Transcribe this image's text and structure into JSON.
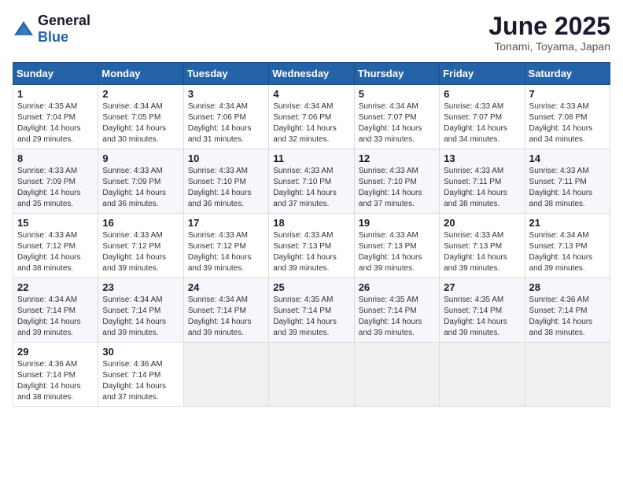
{
  "header": {
    "logo_general": "General",
    "logo_blue": "Blue",
    "month_title": "June 2025",
    "location": "Tonami, Toyama, Japan"
  },
  "calendar": {
    "days_of_week": [
      "Sunday",
      "Monday",
      "Tuesday",
      "Wednesday",
      "Thursday",
      "Friday",
      "Saturday"
    ],
    "weeks": [
      [
        {
          "day": "1",
          "sunrise": "4:35 AM",
          "sunset": "7:04 PM",
          "daylight": "14 hours and 29 minutes."
        },
        {
          "day": "2",
          "sunrise": "4:34 AM",
          "sunset": "7:05 PM",
          "daylight": "14 hours and 30 minutes."
        },
        {
          "day": "3",
          "sunrise": "4:34 AM",
          "sunset": "7:06 PM",
          "daylight": "14 hours and 31 minutes."
        },
        {
          "day": "4",
          "sunrise": "4:34 AM",
          "sunset": "7:06 PM",
          "daylight": "14 hours and 32 minutes."
        },
        {
          "day": "5",
          "sunrise": "4:34 AM",
          "sunset": "7:07 PM",
          "daylight": "14 hours and 33 minutes."
        },
        {
          "day": "6",
          "sunrise": "4:33 AM",
          "sunset": "7:07 PM",
          "daylight": "14 hours and 34 minutes."
        },
        {
          "day": "7",
          "sunrise": "4:33 AM",
          "sunset": "7:08 PM",
          "daylight": "14 hours and 34 minutes."
        }
      ],
      [
        {
          "day": "8",
          "sunrise": "4:33 AM",
          "sunset": "7:09 PM",
          "daylight": "14 hours and 35 minutes."
        },
        {
          "day": "9",
          "sunrise": "4:33 AM",
          "sunset": "7:09 PM",
          "daylight": "14 hours and 36 minutes."
        },
        {
          "day": "10",
          "sunrise": "4:33 AM",
          "sunset": "7:10 PM",
          "daylight": "14 hours and 36 minutes."
        },
        {
          "day": "11",
          "sunrise": "4:33 AM",
          "sunset": "7:10 PM",
          "daylight": "14 hours and 37 minutes."
        },
        {
          "day": "12",
          "sunrise": "4:33 AM",
          "sunset": "7:10 PM",
          "daylight": "14 hours and 37 minutes."
        },
        {
          "day": "13",
          "sunrise": "4:33 AM",
          "sunset": "7:11 PM",
          "daylight": "14 hours and 38 minutes."
        },
        {
          "day": "14",
          "sunrise": "4:33 AM",
          "sunset": "7:11 PM",
          "daylight": "14 hours and 38 minutes."
        }
      ],
      [
        {
          "day": "15",
          "sunrise": "4:33 AM",
          "sunset": "7:12 PM",
          "daylight": "14 hours and 38 minutes."
        },
        {
          "day": "16",
          "sunrise": "4:33 AM",
          "sunset": "7:12 PM",
          "daylight": "14 hours and 39 minutes."
        },
        {
          "day": "17",
          "sunrise": "4:33 AM",
          "sunset": "7:12 PM",
          "daylight": "14 hours and 39 minutes."
        },
        {
          "day": "18",
          "sunrise": "4:33 AM",
          "sunset": "7:13 PM",
          "daylight": "14 hours and 39 minutes."
        },
        {
          "day": "19",
          "sunrise": "4:33 AM",
          "sunset": "7:13 PM",
          "daylight": "14 hours and 39 minutes."
        },
        {
          "day": "20",
          "sunrise": "4:33 AM",
          "sunset": "7:13 PM",
          "daylight": "14 hours and 39 minutes."
        },
        {
          "day": "21",
          "sunrise": "4:34 AM",
          "sunset": "7:13 PM",
          "daylight": "14 hours and 39 minutes."
        }
      ],
      [
        {
          "day": "22",
          "sunrise": "4:34 AM",
          "sunset": "7:14 PM",
          "daylight": "14 hours and 39 minutes."
        },
        {
          "day": "23",
          "sunrise": "4:34 AM",
          "sunset": "7:14 PM",
          "daylight": "14 hours and 39 minutes."
        },
        {
          "day": "24",
          "sunrise": "4:34 AM",
          "sunset": "7:14 PM",
          "daylight": "14 hours and 39 minutes."
        },
        {
          "day": "25",
          "sunrise": "4:35 AM",
          "sunset": "7:14 PM",
          "daylight": "14 hours and 39 minutes."
        },
        {
          "day": "26",
          "sunrise": "4:35 AM",
          "sunset": "7:14 PM",
          "daylight": "14 hours and 39 minutes."
        },
        {
          "day": "27",
          "sunrise": "4:35 AM",
          "sunset": "7:14 PM",
          "daylight": "14 hours and 39 minutes."
        },
        {
          "day": "28",
          "sunrise": "4:36 AM",
          "sunset": "7:14 PM",
          "daylight": "14 hours and 38 minutes."
        }
      ],
      [
        {
          "day": "29",
          "sunrise": "4:36 AM",
          "sunset": "7:14 PM",
          "daylight": "14 hours and 38 minutes."
        },
        {
          "day": "30",
          "sunrise": "4:36 AM",
          "sunset": "7:14 PM",
          "daylight": "14 hours and 37 minutes."
        },
        {
          "day": "",
          "sunrise": "",
          "sunset": "",
          "daylight": ""
        },
        {
          "day": "",
          "sunrise": "",
          "sunset": "",
          "daylight": ""
        },
        {
          "day": "",
          "sunrise": "",
          "sunset": "",
          "daylight": ""
        },
        {
          "day": "",
          "sunrise": "",
          "sunset": "",
          "daylight": ""
        },
        {
          "day": "",
          "sunrise": "",
          "sunset": "",
          "daylight": ""
        }
      ]
    ]
  }
}
